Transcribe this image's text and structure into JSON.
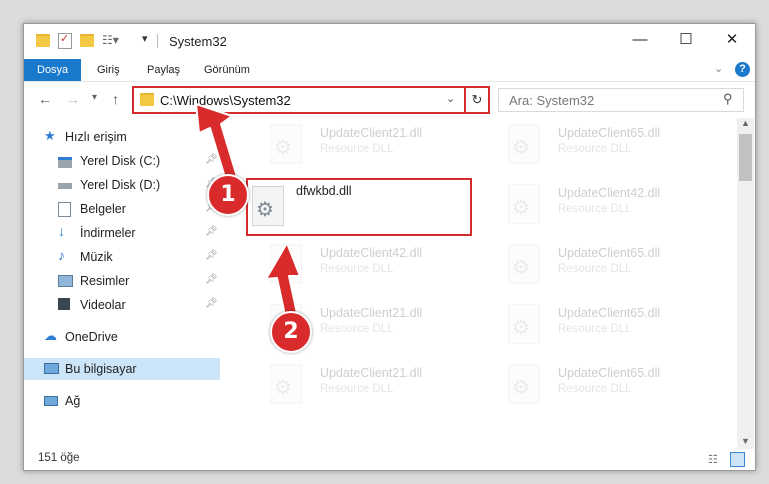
{
  "window": {
    "title": "System32",
    "controls": {
      "minimize": "—",
      "maximize": "☐",
      "close": "✕"
    }
  },
  "ribbon": {
    "tabs": [
      "Dosya",
      "Giriş",
      "Paylaş",
      "Görünüm"
    ],
    "active_tab": "Dosya",
    "accent": "#1979ca"
  },
  "navigation": {
    "address": "C:\\Windows\\System32",
    "search_placeholder": "Ara: System32"
  },
  "sidebar": {
    "items": [
      {
        "label": "Hızlı erişim",
        "icon": "star-icon",
        "pinned": false
      },
      {
        "label": "Yerel Disk (C:)",
        "icon": "drive-icon",
        "pinned": true
      },
      {
        "label": "Yerel Disk (D:)",
        "icon": "drive-icon",
        "pinned": true
      },
      {
        "label": "Belgeler",
        "icon": "document-icon",
        "pinned": true
      },
      {
        "label": "İndirmeler",
        "icon": "download-icon",
        "pinned": true
      },
      {
        "label": "Müzik",
        "icon": "music-icon",
        "pinned": true
      },
      {
        "label": "Resimler",
        "icon": "pictures-icon",
        "pinned": true
      },
      {
        "label": "Videolar",
        "icon": "video-icon",
        "pinned": true
      },
      {
        "label": "OneDrive",
        "icon": "cloud-icon",
        "pinned": false
      },
      {
        "label": "Bu bilgisayar",
        "icon": "computer-icon",
        "pinned": false,
        "selected": true
      },
      {
        "label": "Ağ",
        "icon": "network-icon",
        "pinned": false
      }
    ]
  },
  "files": [
    {
      "name": "UpdateClient21.dll",
      "type": "Resource DLL",
      "faded": true
    },
    {
      "name": "UpdateClient65.dll",
      "type": "Resource DLL",
      "faded": true
    },
    {
      "name": "dfwkbd.dll",
      "type": "",
      "faded": false,
      "highlighted": true
    },
    {
      "name": "UpdateClient42.dll",
      "type": "Resource DLL",
      "faded": true
    },
    {
      "name": "UpdateClient42.dll",
      "type": "Resource DLL",
      "faded": true
    },
    {
      "name": "UpdateClient65.dll",
      "type": "Resource DLL",
      "faded": true
    },
    {
      "name": "UpdateClient21.dll",
      "type": "Resource DLL",
      "faded": true
    },
    {
      "name": "UpdateClient65.dll",
      "type": "Resource DLL",
      "faded": true
    },
    {
      "name": "UpdateClient21.dll",
      "type": "Resource DLL",
      "faded": true
    },
    {
      "name": "UpdateClient65.dll",
      "type": "Resource DLL",
      "faded": true
    }
  ],
  "status": {
    "count": "151 öğe"
  },
  "annotations": {
    "step1": "1",
    "step2": "2",
    "color": "#d92b2b"
  }
}
